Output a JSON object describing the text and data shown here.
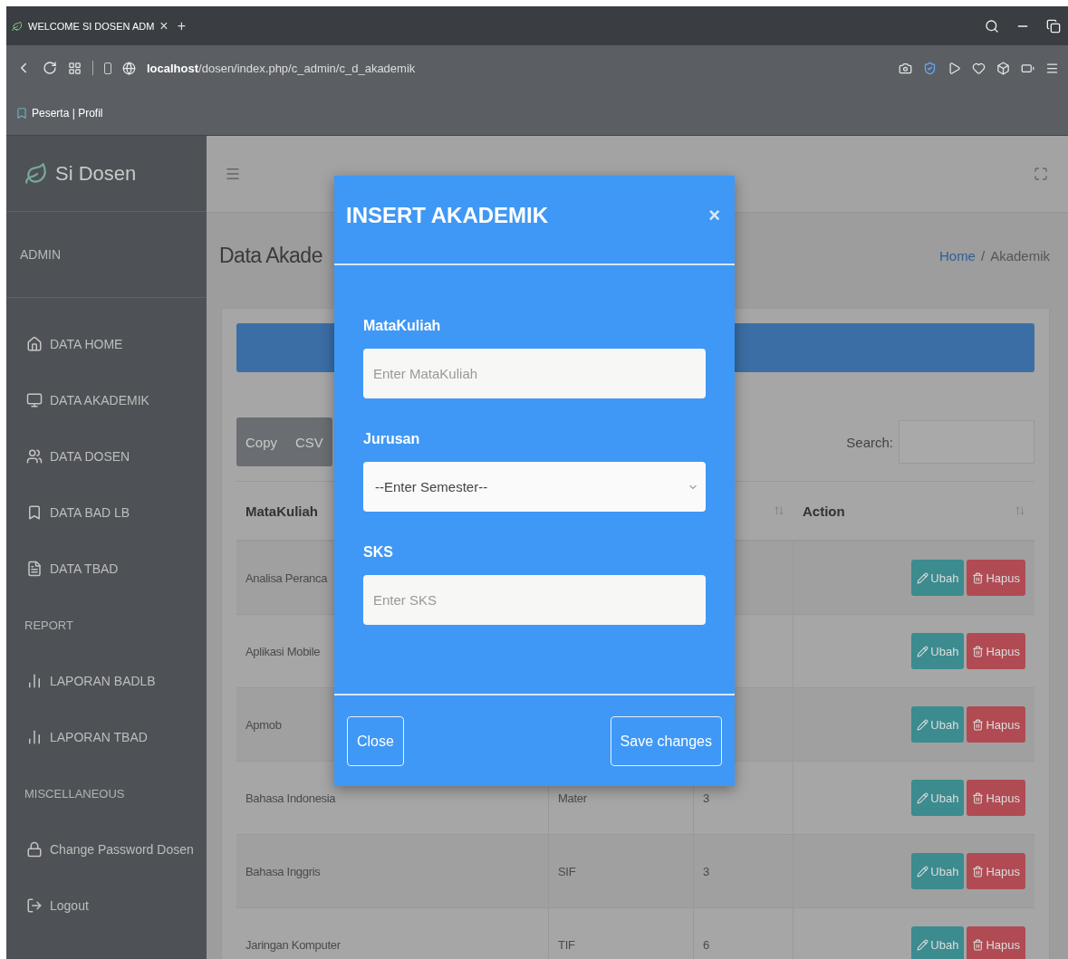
{
  "browser": {
    "tab_title": "WELCOME SI DOSEN ADM",
    "tab_close": "×",
    "new_tab": "+",
    "url": "**localhost**/dosen/index.php/c_admin/c_d_akademik",
    "bookmark": "Peserta | Profil"
  },
  "sidebar": {
    "brand": "Si Dosen",
    "role": "ADMIN",
    "items": [
      {
        "kind": "link",
        "label": "DATA HOME"
      },
      {
        "kind": "link",
        "label": "DATA AKADEMIK"
      },
      {
        "kind": "link",
        "label": "DATA DOSEN"
      },
      {
        "kind": "link",
        "label": "DATA BAD LB"
      },
      {
        "kind": "link",
        "label": "DATA TBAD"
      },
      {
        "kind": "heading",
        "label": "REPORT"
      },
      {
        "kind": "link",
        "label": "LAPORAN BADLB"
      },
      {
        "kind": "link",
        "label": "LAPORAN TBAD"
      },
      {
        "kind": "heading",
        "label": "MISCELLANEOUS"
      },
      {
        "kind": "link",
        "label": "Change Password Dosen"
      },
      {
        "kind": "link",
        "label": "Logout"
      }
    ]
  },
  "page": {
    "title": "Data Akade",
    "breadcrumb": [
      "Home",
      "Akademik"
    ],
    "breadcrumb_separator": "/"
  },
  "toolbar": {
    "buttons": [
      "Copy",
      "CSV"
    ],
    "search_label": "Search:"
  },
  "table": {
    "columns": [
      {
        "label": "MataKuliah"
      },
      {
        "label": "Action"
      }
    ],
    "rows": [
      {
        "matakuliah": "Analisa Peranca",
        "actions": [
          "Ubah",
          "Hapus"
        ]
      },
      {
        "matakuliah": "Aplikasi Mobile",
        "actions": [
          "Ubah",
          "Hapus"
        ]
      },
      {
        "matakuliah": "Apmob",
        "actions": [
          "Ubah",
          "Hapus"
        ]
      },
      {
        "matakuliah": "Bahasa Indonesia",
        "column_2": "Mater",
        "column_3": "3",
        "actions": [
          "Ubah",
          "Hapus"
        ]
      },
      {
        "matakuliah": "Bahasa Inggris",
        "column_2": "SIF",
        "column_3": "3",
        "actions": [
          "Ubah",
          "Hapus"
        ]
      },
      {
        "matakuliah": "Jaringan Komputer",
        "column_2": "TIF",
        "column_3": "6",
        "actions": [
          "Ubah",
          "Hapus"
        ]
      }
    ]
  },
  "modal": {
    "title": "INSERT AKADEMIK",
    "close": "×",
    "fields": [
      {
        "kind": "input",
        "label": "MataKuliah",
        "placeholder": "Enter MataKuliah"
      },
      {
        "kind": "select",
        "label": "Jurusan",
        "value": "--Enter Semester--"
      },
      {
        "kind": "input",
        "label": "SKS",
        "placeholder": "Enter SKS"
      }
    ],
    "buttons": [
      "Close",
      "Save changes"
    ]
  }
}
